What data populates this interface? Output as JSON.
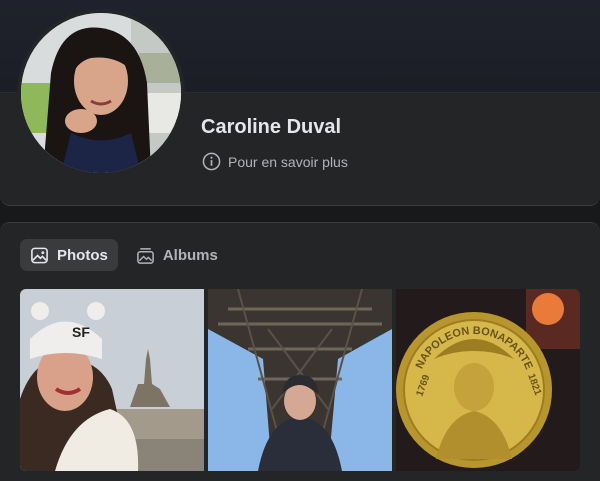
{
  "profile": {
    "name": "Caroline Duval",
    "about_label": "Pour en savoir plus",
    "avatar_icon": "profile-photo-woman"
  },
  "tabs": [
    {
      "label": "Photos",
      "icon": "photo-icon",
      "active": true
    },
    {
      "label": "Albums",
      "icon": "album-icon",
      "active": false
    }
  ],
  "photos": [
    {
      "description_icon": "selfie-mont-saint-michel"
    },
    {
      "description_icon": "selfie-eiffel-tower"
    },
    {
      "description_icon": "napoleon-coin",
      "coin_text_top": "NAPOLEON BONAPARTE",
      "coin_year_left": "1769",
      "coin_year_right": "1821"
    }
  ],
  "colors": {
    "background": "#18191a",
    "card": "#242526",
    "active_tab": "#3a3b3c",
    "text_primary": "#e4e6eb",
    "text_secondary": "#b0b3b8"
  }
}
